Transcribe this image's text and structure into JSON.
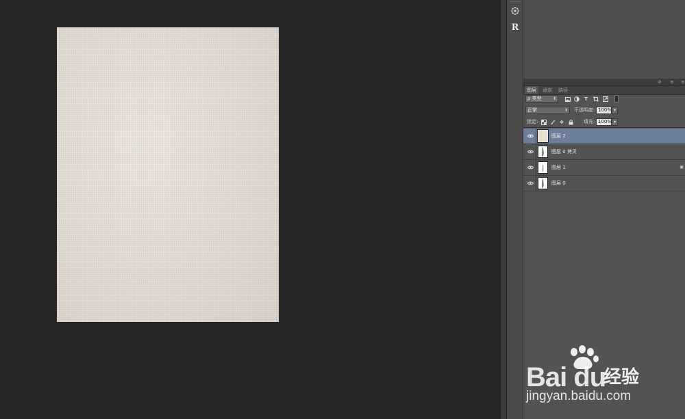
{
  "tabs": [
    "图层",
    "通道",
    "路径"
  ],
  "filter": {
    "kind_label": "ρ 类型",
    "icons": [
      "image-filter-icon",
      "adjustment-filter-icon",
      "type-filter-icon",
      "shape-filter-icon",
      "smart-object-filter-icon"
    ]
  },
  "blend": {
    "mode": "正常",
    "opacity_label": "不透明度:",
    "opacity_value": "100%"
  },
  "lock": {
    "label": "锁定:",
    "fill_label": "填充:",
    "fill_value": "100%"
  },
  "layers": [
    {
      "name": "图层 2",
      "selected": true,
      "thumb": "texture"
    },
    {
      "name": "图层 0 拷贝",
      "selected": false,
      "thumb": "figure"
    },
    {
      "name": "图层 1",
      "selected": false,
      "thumb": "figure-light"
    },
    {
      "name": "图层 0",
      "selected": false,
      "thumb": "figure"
    }
  ],
  "toolstrip": {
    "buttons": [
      "3d-settings-icon",
      "R"
    ]
  },
  "watermark": {
    "logo": "Bai du",
    "cn": "经验",
    "url": "jingyan.baidu.com"
  },
  "colors": {
    "selected_layer": "#6c7e99",
    "canvas_bg": "#262626",
    "panel_bg": "#535353",
    "document": "#e6ded6"
  }
}
